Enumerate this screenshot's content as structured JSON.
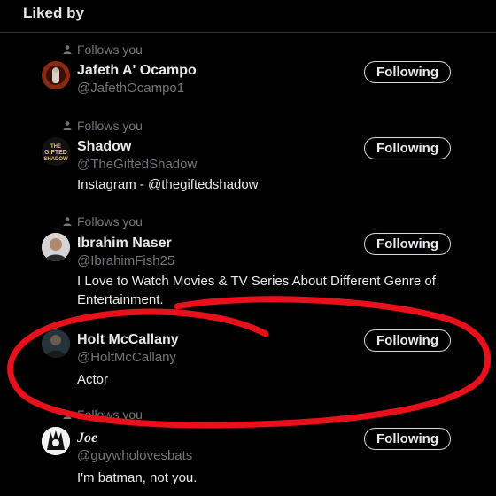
{
  "header": {
    "title": "Liked by"
  },
  "follows_label": "Follows you",
  "button_label": "Following",
  "users": [
    {
      "name": "Jafeth A' Ocampo",
      "handle": "@JafethOcampo1",
      "bio": ""
    },
    {
      "name": "Shadow",
      "handle": "@TheGiftedShadow",
      "bio": "Instagram - @thegiftedshadow",
      "avatar_text": "THE GIFTED SHADOW"
    },
    {
      "name": "Ibrahim Naser",
      "handle": "@IbrahimFish25",
      "bio": "I Love to Watch Movies & TV Series About Different Genre of Entertainment."
    },
    {
      "name": "Holt McCallany",
      "handle": "@HoltMcCallany",
      "bio": "Actor"
    },
    {
      "name": "Joe",
      "handle": "@guywholovesbats",
      "bio": "I'm batman, not you."
    }
  ],
  "colors": {
    "background": "#000000",
    "secondary_text": "#71767b",
    "annotation": "#e8101a"
  }
}
